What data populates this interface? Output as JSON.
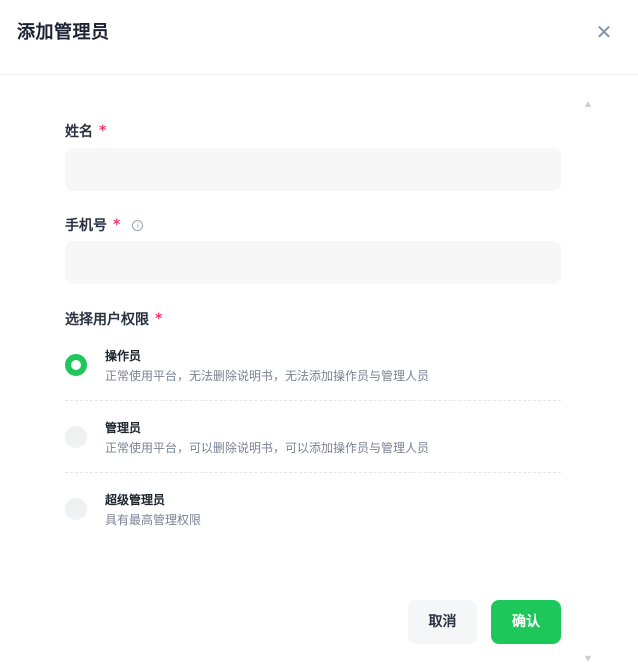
{
  "dialog": {
    "title": "添加管理员",
    "close_icon": "close-icon"
  },
  "form": {
    "name": {
      "label": "姓名",
      "required": "*",
      "value": "",
      "placeholder": ""
    },
    "phone": {
      "label": "手机号",
      "required": "*",
      "info_icon": "ⓘ",
      "value": "",
      "placeholder": ""
    },
    "permission": {
      "label": "选择用户权限",
      "required": "*",
      "selected": "操作员",
      "options": [
        {
          "title": "操作员",
          "desc": "正常使用平台，无法删除说明书，无法添加操作员与管理人员",
          "checked": true
        },
        {
          "title": "管理员",
          "desc": "正常使用平台，可以删除说明书，可以添加操作员与管理人员",
          "checked": false
        },
        {
          "title": "超级管理员",
          "desc": "具有最高管理权限",
          "checked": false
        }
      ]
    }
  },
  "actions": {
    "cancel_label": "取消",
    "confirm_label": "确认"
  },
  "colors": {
    "accent": "#1ec75a",
    "required": "#f0386b"
  }
}
